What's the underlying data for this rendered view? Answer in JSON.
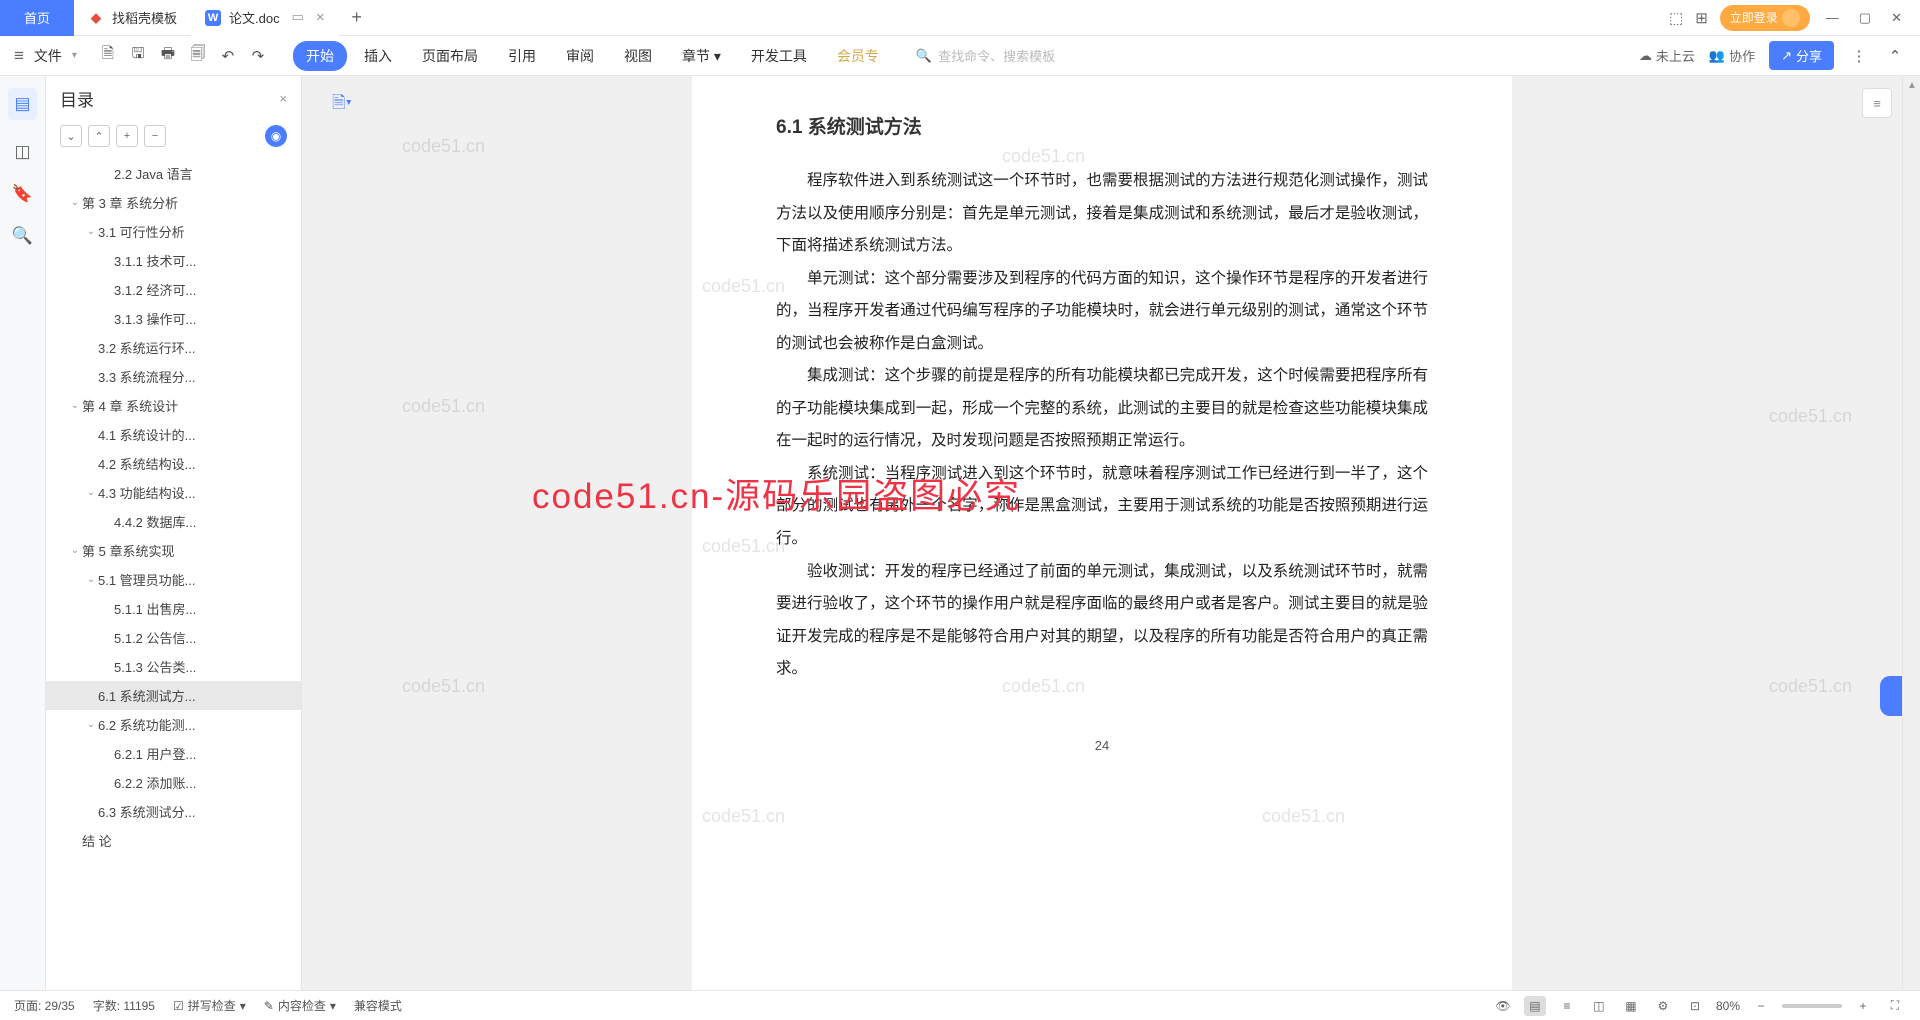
{
  "tabs": {
    "home": "首页",
    "template": "找稻壳模板",
    "doc": "论文.doc"
  },
  "login": "立即登录",
  "file": "文件",
  "ribbon": [
    "开始",
    "插入",
    "页面布局",
    "引用",
    "审阅",
    "视图",
    "章节",
    "开发工具",
    "会员专"
  ],
  "search": "查找命令、搜索模板",
  "cloud": "未上云",
  "collab": "协作",
  "share": "分享",
  "outline_title": "目录",
  "outline": [
    {
      "lv": 3,
      "t": "2.2 Java 语言"
    },
    {
      "lv": 1,
      "t": "第 3 章  系统分析",
      "c": 1
    },
    {
      "lv": 2,
      "t": "3.1 可行性分析",
      "c": 1
    },
    {
      "lv": 3,
      "t": "3.1.1 技术可..."
    },
    {
      "lv": 3,
      "t": "3.1.2 经济可..."
    },
    {
      "lv": 3,
      "t": "3.1.3 操作可..."
    },
    {
      "lv": 2,
      "t": "3.2 系统运行环..."
    },
    {
      "lv": 2,
      "t": "3.3 系统流程分..."
    },
    {
      "lv": 1,
      "t": "第 4 章   系统设计",
      "c": 1
    },
    {
      "lv": 2,
      "t": "4.1 系统设计的..."
    },
    {
      "lv": 2,
      "t": "4.2 系统结构设..."
    },
    {
      "lv": 2,
      "t": "4.3 功能结构设...",
      "c": 1
    },
    {
      "lv": 3,
      "t": "4.4.2 数据库..."
    },
    {
      "lv": 1,
      "t": "第 5 章系统实现",
      "c": 1
    },
    {
      "lv": 2,
      "t": "5.1 管理员功能...",
      "c": 1
    },
    {
      "lv": 3,
      "t": "5.1.1 出售房..."
    },
    {
      "lv": 3,
      "t": "5.1.2 公告信..."
    },
    {
      "lv": 3,
      "t": "5.1.3 公告类..."
    },
    {
      "lv": 2,
      "t": "6.1 系统测试方...",
      "a": 1
    },
    {
      "lv": 2,
      "t": "6.2 系统功能测...",
      "c": 1
    },
    {
      "lv": 3,
      "t": "6.2.1 用户登..."
    },
    {
      "lv": 3,
      "t": "6.2.2 添加账..."
    },
    {
      "lv": 2,
      "t": "6.3 系统测试分..."
    },
    {
      "lv": 1,
      "t": "结   论"
    }
  ],
  "doc": {
    "heading": "6.1 系统测试方法",
    "p1": "程序软件进入到系统测试这一个环节时，也需要根据测试的方法进行规范化测试操作，测试方法以及使用顺序分别是：首先是单元测试，接着是集成测试和系统测试，最后才是验收测试，下面将描述系统测试方法。",
    "p2": "单元测试：这个部分需要涉及到程序的代码方面的知识，这个操作环节是程序的开发者进行的，当程序开发者通过代码编写程序的子功能模块时，就会进行单元级别的测试，通常这个环节的测试也会被称作是白盒测试。",
    "p3": "集成测试：这个步骤的前提是程序的所有功能模块都已完成开发，这个时候需要把程序所有的子功能模块集成到一起，形成一个完整的系统，此测试的主要目的就是检查这些功能模块集成在一起时的运行情况，及时发现问题是否按照预期正常运行。",
    "p4": "系统测试：当程序测试进入到这个环节时，就意味着程序测试工作已经进行到一半了，这个部分的测试也有另外一个名字，称作是黑盒测试，主要用于测试系统的功能是否按照预期进行运行。",
    "p5": "验收测试：开发的程序已经通过了前面的单元测试，集成测试，以及系统测试环节时，就需要进行验收了，这个环节的操作用户就是程序面临的最终用户或者是客户。测试主要目的就是验证开发完成的程序是不是能够符合用户对其的期望，以及程序的所有功能是否符合用户的真正需求。",
    "pagenum": "24"
  },
  "wm": "code51.cn",
  "wm_red": "code51.cn-源码乐园盗图必究",
  "status": {
    "page": "页面: 29/35",
    "words": "字数: 11195",
    "spell": "拼写检查",
    "content": "内容检查",
    "compat": "兼容模式",
    "zoom": "80%"
  }
}
